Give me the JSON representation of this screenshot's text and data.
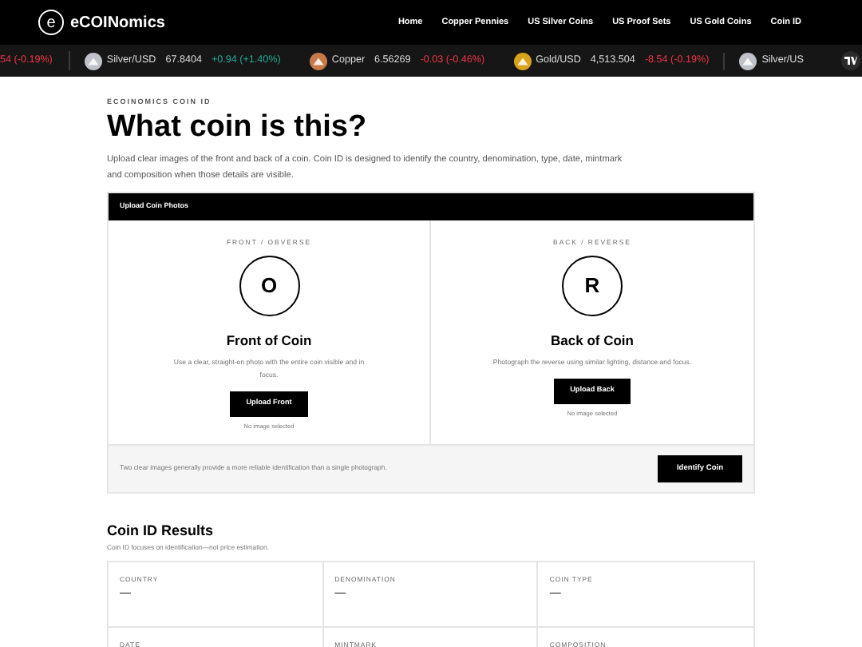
{
  "header": {
    "logo_letter": "e",
    "brand": "eCOINomics",
    "nav": [
      {
        "label": "Home"
      },
      {
        "label": "Copper Pennies"
      },
      {
        "label": "US Silver Coins"
      },
      {
        "label": "US Proof Sets"
      },
      {
        "label": "US Gold Coins"
      },
      {
        "label": "Coin ID"
      }
    ]
  },
  "ticker": [
    {
      "kind": "partial",
      "change": "54 (-0.19%)",
      "rising": false
    },
    {
      "kind": "full",
      "color": "#bfc3c9",
      "name": "Silver/USD",
      "price": "67.8404",
      "change": "+0.94 (+1.40%)",
      "rising": true
    },
    {
      "kind": "full",
      "color": "#c8794a",
      "name": "Copper",
      "price": "6.56269",
      "change": "-0.03 (-0.46%)",
      "rising": false
    },
    {
      "kind": "full",
      "color": "#d9a21b",
      "name": "Gold/USD",
      "price": "4,513.504",
      "change": "-8.54 (-0.19%)",
      "rising": false
    },
    {
      "kind": "cut",
      "color": "#bfc3c9",
      "name": "Silver/US"
    }
  ],
  "page": {
    "eyebrow": "ECOINOMICS COIN ID",
    "title": "What coin is this?",
    "description": "Upload clear images of the front and back of a coin. Coin ID is designed to identify the country, denomination, type, date, mintmark and composition when those details are visible."
  },
  "upload": {
    "title": "Upload Coin Photos",
    "sides": [
      {
        "eyebrow": "FRONT / OBVERSE",
        "letter": "O",
        "title": "Front of Coin",
        "hint": "Use a clear, straight-on photo with the entire coin visible and in focus.",
        "button": "Upload Front",
        "status": "No image selected"
      },
      {
        "eyebrow": "BACK / REVERSE",
        "letter": "R",
        "title": "Back of Coin",
        "hint": "Photograph the reverse using similar lighting, distance and focus.",
        "button": "Upload Back",
        "status": "No image selected"
      }
    ],
    "footer_note": "Two clear images generally provide a more reliable identification than a single photograph.",
    "submit": "Identify Coin"
  },
  "results": {
    "title": "Coin ID Results",
    "subtitle": "Coin ID focuses on identification—not price estimation.",
    "fields": [
      {
        "label": "COUNTRY",
        "value": "—"
      },
      {
        "label": "DENOMINATION",
        "value": "—"
      },
      {
        "label": "COIN TYPE",
        "value": "—"
      },
      {
        "label": "DATE"
      },
      {
        "label": "MINTMARK"
      },
      {
        "label": "COMPOSITION"
      }
    ]
  }
}
